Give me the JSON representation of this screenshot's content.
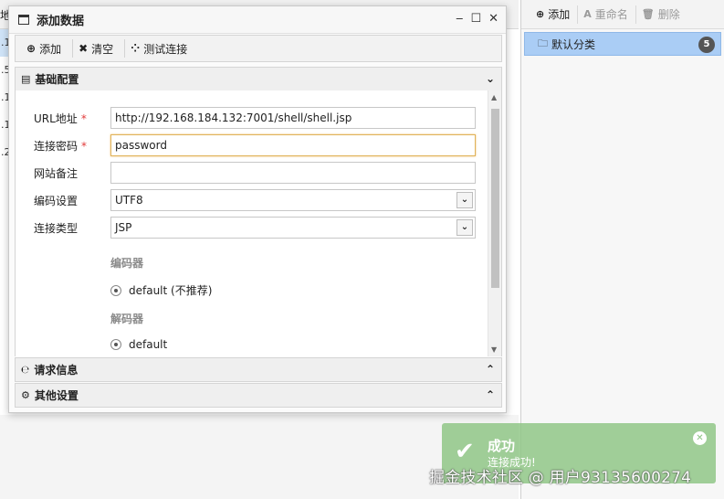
{
  "background": {
    "header_text": "地",
    "row_texts": [
      ".1",
      ".5",
      ".1",
      ".1",
      ".2"
    ]
  },
  "right_panel": {
    "toolbar": {
      "add_label": "添加",
      "rename_label": "重命名",
      "delete_label": "删除"
    },
    "category": {
      "name": "默认分类",
      "count": "5"
    }
  },
  "dialog": {
    "title": "添加数据",
    "toolbar": {
      "add_label": "添加",
      "clear_label": "清空",
      "test_label": "测试连接"
    },
    "sections": {
      "basic": "基础配置",
      "request": "请求信息",
      "other": "其他设置"
    },
    "form": {
      "url_label": "URL地址",
      "url_value": "http://192.168.184.132:7001/shell/shell.jsp",
      "password_label": "连接密码",
      "password_value": "password",
      "note_label": "网站备注",
      "note_value": "",
      "encoding_label": "编码设置",
      "encoding_value": "UTF8",
      "type_label": "连接类型",
      "type_value": "JSP",
      "required_mark": "*",
      "encoder_title": "编码器",
      "encoder_option": "default (不推荐)",
      "decoder_title": "解码器",
      "decoder_option": "default"
    }
  },
  "toast": {
    "title": "成功",
    "message": "连接成功!"
  },
  "watermark": "掘金技术社区 @ 用户93135600274",
  "colors": {
    "selected_category": "#aacdf5",
    "toast_bg": "#8cc482",
    "required": "#e23a3a"
  }
}
